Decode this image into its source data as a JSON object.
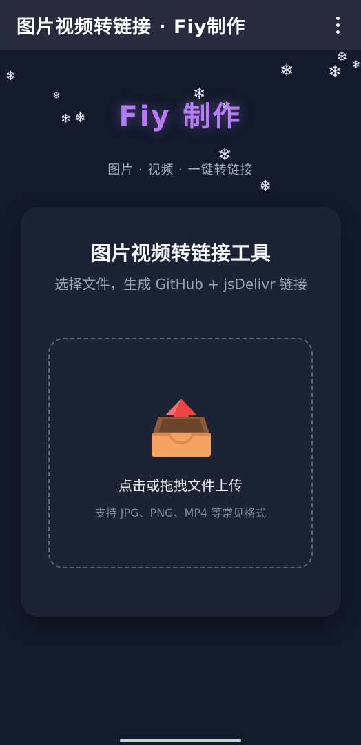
{
  "appbar": {
    "title": "图片视频转链接 · Fiy制作",
    "menu_icon": "more-vert-icon"
  },
  "header": {
    "brand": "Fiy 制作",
    "subtitle": "图片 · 视频 · 一键转链接"
  },
  "card": {
    "title": "图片视频转链接工具",
    "description": "选择文件，生成 GitHub + jsDelivr 链接",
    "dropzone": {
      "icon": "upload-tray-icon",
      "title": "点击或拖拽文件上传",
      "hint": "支持 JPG、PNG、MP4 等常见格式"
    }
  },
  "decorations": {
    "snowflake_glyph": "❄",
    "snowflake_icon": "snowflake-icon"
  },
  "colors": {
    "background": "#121a2c",
    "appbar": "#282b3d",
    "card": "#1b2335",
    "brand_purple": "#b57cf3",
    "upload_arrow_red": "#ef4444",
    "upload_tray_orange": "#f4a261"
  }
}
